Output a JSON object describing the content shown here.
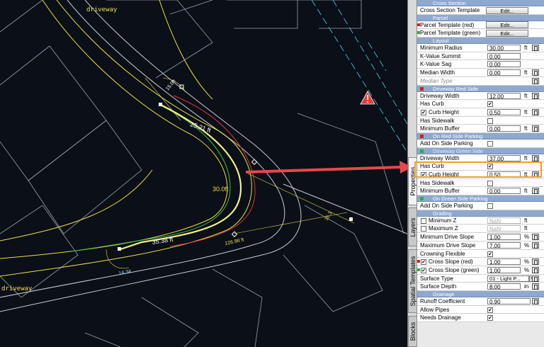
{
  "canvas": {
    "road_label_top": "driveway",
    "road_label_bottom": "driveway",
    "dim_upper": "25.21 ft",
    "dim_mid": "30.0ft",
    "dim_lower": "35.38 ft",
    "dim_small_top": "15.0ft",
    "dim_side": "35.3",
    "dim_low_right": "126.98 ft",
    "dim_bottom": "14.34",
    "warning_icon": "warning-triangle-icon",
    "arrow_color": "#e8474a"
  },
  "tabs": [
    "Properties",
    "Layers",
    "Spatial Templates",
    "Blocks"
  ],
  "panel": {
    "cross_section": {
      "header": "Cross Section",
      "template_label": "Cross Section Template",
      "edit": "Edit..."
    },
    "parcel": {
      "header": "Parcel",
      "red_label": "Parcel Template (red)",
      "green_label": "Parcel Template (green)",
      "edit": "Edit..."
    },
    "layout": {
      "header": "Layout",
      "min_radius_label": "Minimum Radius",
      "min_radius": "30.00",
      "k_summit_label": "K-Value Summit",
      "k_summit": "0.00",
      "k_sag_label": "K-Value Sag",
      "k_sag": "0.00",
      "median_width_label": "Median Width",
      "median_width": "0.00",
      "median_type_label": "Median Type"
    },
    "red_side": {
      "header": "Driveway Red Side",
      "width_label": "Driveway Width",
      "width": "12.00",
      "has_curb_label": "Has Curb",
      "curb_height_label": "Curb Height",
      "curb_height": "0.50",
      "has_sidewalk_label": "Has Sidewalk",
      "min_buffer_label": "Minimum Buffer",
      "min_buffer": "0.00"
    },
    "red_parking": {
      "header": "On Red Side Parking",
      "add_label": "Add On Side Parking"
    },
    "green_side": {
      "header": "Driveway Green Side",
      "width_label": "Driveway Width",
      "width": "37.00",
      "has_curb_label": "Has Curb",
      "curb_height_label": "Curb Height",
      "curb_height": "0.50",
      "has_sidewalk_label": "Has Sidewalk",
      "min_buffer_label": "Minimum Buffer",
      "min_buffer": "0.00"
    },
    "green_parking": {
      "header": "On Green Side Parking",
      "add_label": "Add On Side Parking"
    },
    "grading": {
      "header": "Grading",
      "min_z_label": "Minimum Z",
      "min_z": "NaN",
      "max_z_label": "Maximum Z",
      "max_z": "NaN",
      "min_slope_label": "Minimum Drive Slope",
      "min_slope": "1.00",
      "max_slope_label": "Maximum Drive Slope",
      "max_slope": "7.00",
      "crowning_label": "Crowning Flexible",
      "cross_red_label": "Cross Slope (red)",
      "cross_red": "1.00",
      "cross_green_label": "Cross Slope (green)",
      "cross_green": "1.00",
      "surface_type_label": "Surface Type",
      "surface_type": "01 - Light P...",
      "surface_depth_label": "Surface Depth",
      "surface_depth": "8.00"
    },
    "drainage": {
      "header": "Drainage",
      "runoff_label": "Runoff Coefficient",
      "runoff": "0.90",
      "allow_pipes_label": "Allow Pipes",
      "needs_drainage_label": "Needs Drainage"
    },
    "units": {
      "ft": "ft",
      "pct": "%",
      "in": "in"
    },
    "check": "✔",
    "colors": {
      "red_swatch": "#d21f1f",
      "green_swatch": "#2cae3a",
      "section_header": "#8ea8cf",
      "highlight": "#f0a020"
    }
  }
}
